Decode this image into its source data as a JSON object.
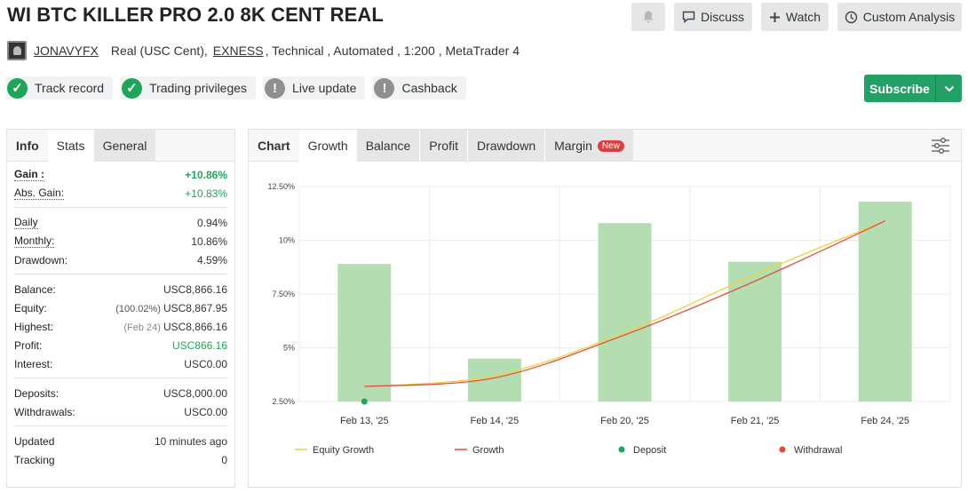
{
  "header": {
    "title": "WI BTC KILLER PRO 2.0 8K CENT REAL",
    "discuss_label": "Discuss",
    "watch_label": "Watch",
    "custom_analysis_label": "Custom Analysis"
  },
  "account": {
    "username": "JONAVYFX",
    "type": "Real (USC Cent),",
    "broker": "EXNESS",
    "details": ", Technical , Automated , 1:200 , MetaTrader 4"
  },
  "badges": [
    {
      "label": "Track record",
      "status": "verified"
    },
    {
      "label": "Trading privileges",
      "status": "verified"
    },
    {
      "label": "Live update",
      "status": "warning"
    },
    {
      "label": "Cashback",
      "status": "warning"
    }
  ],
  "subscribe_label": "Subscribe",
  "info_tabs": [
    "Info",
    "Stats",
    "General"
  ],
  "stats": {
    "gain": {
      "label": "Gain :",
      "value": "+10.86%"
    },
    "abs_gain": {
      "label": "Abs. Gain:",
      "value": "+10.83%"
    },
    "daily": {
      "label": "Daily",
      "value": "0.94%"
    },
    "monthly": {
      "label": "Monthly:",
      "value": "10.86%"
    },
    "drawdown": {
      "label": "Drawdown:",
      "value": "4.59%"
    },
    "balance": {
      "label": "Balance:",
      "value": "USC8,866.16"
    },
    "equity": {
      "label": "Equity:",
      "sub": "(100.02%)",
      "value": "USC8,867.95"
    },
    "highest": {
      "label": "Highest:",
      "sub": "(Feb 24)",
      "value": "USC8,866.16"
    },
    "profit": {
      "label": "Profit:",
      "value": "USC866.16"
    },
    "interest": {
      "label": "Interest:",
      "value": "USC0.00"
    },
    "deposits": {
      "label": "Deposits:",
      "value": "USC8,000.00"
    },
    "withdrawals": {
      "label": "Withdrawals:",
      "value": "USC0.00"
    },
    "updated": {
      "label": "Updated",
      "value": "10 minutes ago"
    },
    "tracking": {
      "label": "Tracking",
      "value": "0"
    }
  },
  "chart_tabs": [
    "Chart",
    "Growth",
    "Balance",
    "Profit",
    "Drawdown",
    "Margin"
  ],
  "new_badge": "New",
  "colors": {
    "bar": "#b5ddb2",
    "equity": "#f0d040",
    "growth": "#e05040",
    "deposit": "#1ea55a",
    "withdrawal": "#e04a3a",
    "accent": "#23a065"
  },
  "chart_data": {
    "type": "bar",
    "categories": [
      "Feb 13, '25",
      "Feb 14, '25",
      "Feb 20, '25",
      "Feb 21, '25",
      "Feb 24, '25"
    ],
    "bars": [
      8.9,
      4.5,
      10.8,
      9.0,
      11.8
    ],
    "equity_growth": [
      3.2,
      3.7,
      5.7,
      8.4,
      10.9
    ],
    "growth": [
      3.2,
      3.6,
      5.6,
      8.1,
      10.9
    ],
    "deposit_points": [
      {
        "category": "Feb 13, '25",
        "value": 2.5
      }
    ],
    "y_ticks": [
      "12.50%",
      "10%",
      "7.50%",
      "5%",
      "2.50%"
    ],
    "ylim": [
      2.5,
      12.5
    ],
    "legend": [
      "Equity Growth",
      "Growth",
      "Deposit",
      "Withdrawal"
    ],
    "legend_position": "bottom",
    "grid": true
  }
}
